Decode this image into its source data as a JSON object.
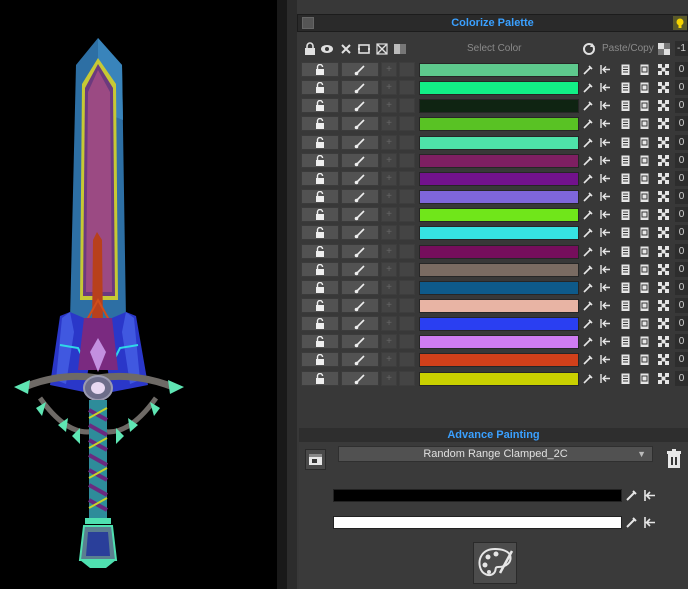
{
  "palette": {
    "title": "Colorize Palette",
    "select_color_label": "Select Color",
    "paste_copy_label": "Paste/Copy",
    "header_value": "-1",
    "rows": [
      {
        "color": "#5ec98d",
        "value": "0"
      },
      {
        "color": "#12ef86",
        "value": "0"
      },
      {
        "color": "#0f2412",
        "value": "0"
      },
      {
        "color": "#59c224",
        "value": "0"
      },
      {
        "color": "#4ee2a9",
        "value": "0"
      },
      {
        "color": "#7e1f62",
        "value": "0"
      },
      {
        "color": "#72128c",
        "value": "0"
      },
      {
        "color": "#7e66db",
        "value": "0"
      },
      {
        "color": "#70e61a",
        "value": "0"
      },
      {
        "color": "#36e2e2",
        "value": "0"
      },
      {
        "color": "#760e5c",
        "value": "0"
      },
      {
        "color": "#7a6b62",
        "value": "0"
      },
      {
        "color": "#0e5a8a",
        "value": "0"
      },
      {
        "color": "#e8b4a4",
        "value": "0"
      },
      {
        "color": "#2a3ff2",
        "value": "0"
      },
      {
        "color": "#cf7cf2",
        "value": "0"
      },
      {
        "color": "#d1401a",
        "value": "0"
      },
      {
        "color": "#c9d000",
        "value": "0"
      }
    ]
  },
  "advance": {
    "title": "Advance Painting",
    "mode_selected": "Random Range Clamped_2C",
    "gradient_start_color": "#000000",
    "gradient_end_color": "#ffffff"
  },
  "colors": {
    "accent_blue": "#3aa0ff",
    "panel_bg": "#383838"
  }
}
